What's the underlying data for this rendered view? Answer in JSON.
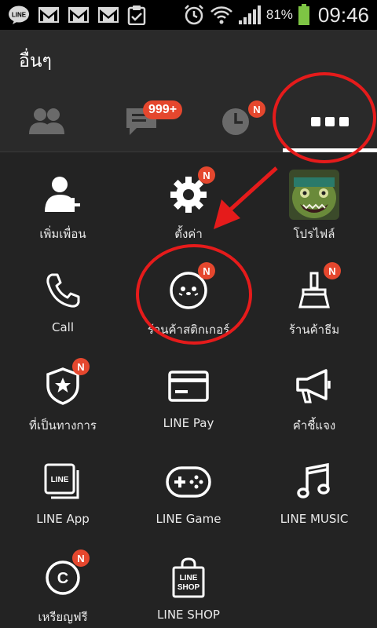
{
  "status_bar": {
    "app_icons": [
      "line-icon",
      "gmail-icon",
      "gmail-icon",
      "gmail-icon",
      "clipboard-icon"
    ],
    "battery_percent": "81%",
    "time": "09:46"
  },
  "header": {
    "title": "อื่นๆ"
  },
  "tabs": [
    {
      "name": "friends",
      "icon": "friends-icon",
      "badge": ""
    },
    {
      "name": "chats",
      "icon": "chat-icon",
      "badge": "999+"
    },
    {
      "name": "timeline",
      "icon": "clock-icon",
      "badge": "N"
    },
    {
      "name": "more",
      "icon": "more-icon",
      "badge": ""
    }
  ],
  "grid": [
    {
      "label": "เพิ่มเพื่อน",
      "icon": "add-friend-icon",
      "badge": ""
    },
    {
      "label": "ตั้งค่า",
      "icon": "gear-icon",
      "badge": "N"
    },
    {
      "label": "โปรไฟล์",
      "icon": "profile-avatar",
      "badge": ""
    },
    {
      "label": "Call",
      "icon": "phone-icon",
      "badge": ""
    },
    {
      "label": "ร้านค้าสติกเกอร์",
      "icon": "sticker-icon",
      "badge": "N"
    },
    {
      "label": "ร้านค้าธีม",
      "icon": "theme-brush-icon",
      "badge": "N"
    },
    {
      "label": "ที่เป็นทางการ",
      "icon": "official-shield-icon",
      "badge": "N"
    },
    {
      "label": "LINE Pay",
      "icon": "card-icon",
      "badge": ""
    },
    {
      "label": "คำชี้แจง",
      "icon": "megaphone-icon",
      "badge": ""
    },
    {
      "label": "LINE App",
      "icon": "line-app-icon",
      "badge": ""
    },
    {
      "label": "LINE Game",
      "icon": "gamepad-icon",
      "badge": ""
    },
    {
      "label": "LINE MUSIC",
      "icon": "music-note-icon",
      "badge": ""
    },
    {
      "label": "เหรียญฟรี",
      "icon": "coin-icon",
      "badge": "N"
    },
    {
      "label": "LINE SHOP",
      "icon": "shop-bag-icon",
      "badge": ""
    }
  ],
  "shop_bag_text": [
    "LINE",
    "SHOP"
  ],
  "line_app_text": "LINE",
  "coin_text": "C",
  "annotation_color": "#e51b1b",
  "badge_color": "#e5472e"
}
